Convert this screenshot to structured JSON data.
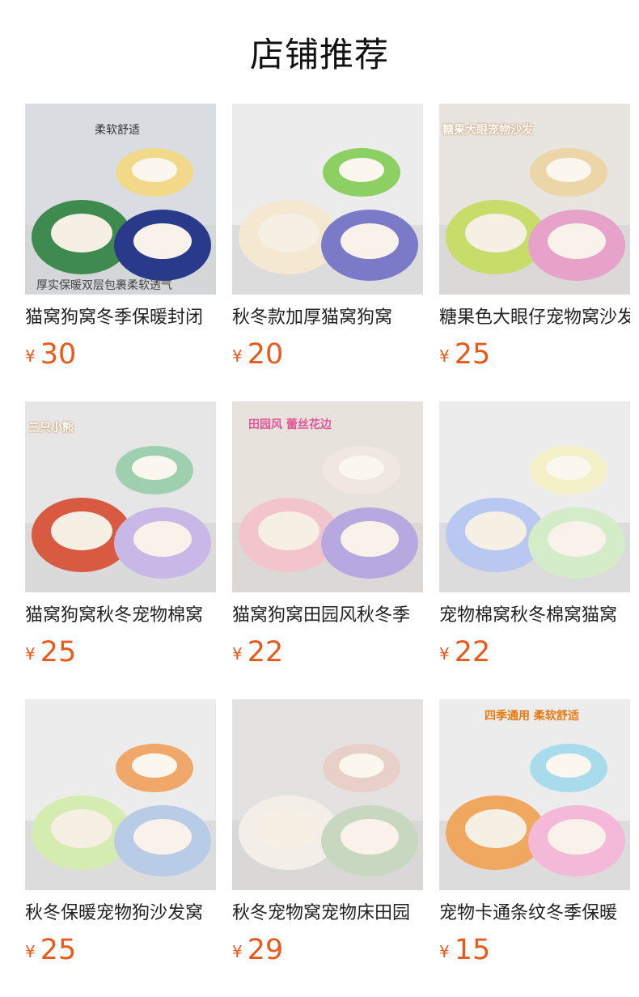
{
  "header": {
    "title": "店铺推荐"
  },
  "currency": "¥",
  "products": [
    {
      "title": "猫窝狗窝冬季保暖封闭",
      "price": "30",
      "overlay_top": "柔软舒适",
      "overlay_bottom": "厚实保暖双层包裹柔软透气",
      "colors": {
        "bg": "#d9dde2",
        "a": "#3f8a4e",
        "b": "#2a3a8a",
        "c": "#f2d98a"
      }
    },
    {
      "title": "秋冬款加厚猫窝狗窝",
      "price": "20",
      "overlay_top": "",
      "overlay_bottom": "",
      "colors": {
        "bg": "#ececec",
        "a": "#f4e8d0",
        "b": "#7a7ac8",
        "c": "#8ccf62"
      }
    },
    {
      "title": "糖果色大眼仔宠物窝沙发",
      "price": "25",
      "overlay_top": "糖果大眼宠物沙发",
      "overlay_bottom": "",
      "colors": {
        "bg": "#e8e4e0",
        "a": "#c8dc6a",
        "b": "#e6a2c8",
        "c": "#ecd6a8"
      }
    },
    {
      "title": "猫窝狗窝秋冬宠物棉窝",
      "price": "25",
      "overlay_top": "三只小熊",
      "overlay_bottom": "",
      "colors": {
        "bg": "#e6e6e6",
        "a": "#d85a40",
        "b": "#c8b8e8",
        "c": "#9ed0b0"
      }
    },
    {
      "title": "猫窝狗窝田园风秋冬季",
      "price": "22",
      "overlay_top": "田园风 蕾丝花边",
      "overlay_bottom": "",
      "colors": {
        "bg": "#e8e2dc",
        "a": "#f2c4cc",
        "b": "#b8a8e0",
        "c": "#f0e8e0"
      }
    },
    {
      "title": "宠物棉窝秋冬棉窝猫窝",
      "price": "22",
      "overlay_top": "",
      "overlay_bottom": "",
      "colors": {
        "bg": "#ececec",
        "a": "#b8c8f0",
        "b": "#d4ecc8",
        "c": "#f4f0c8"
      }
    },
    {
      "title": "秋冬保暖宠物狗沙发窝",
      "price": "25",
      "overlay_top": "",
      "overlay_bottom": "",
      "colors": {
        "bg": "#ececec",
        "a": "#d4ecb0",
        "b": "#b8cce8",
        "c": "#f0a86a"
      }
    },
    {
      "title": "秋冬宠物窝宠物床田园",
      "price": "29",
      "overlay_top": "",
      "overlay_bottom": "",
      "colors": {
        "bg": "#e4e2e0",
        "a": "#f4eee8",
        "b": "#c8d8c0",
        "c": "#e8d0c8"
      }
    },
    {
      "title": "宠物卡通条纹冬季保暖",
      "price": "15",
      "overlay_top": "四季通用 柔软舒适",
      "overlay_bottom": "",
      "colors": {
        "bg": "#ececec",
        "a": "#f0a860",
        "b": "#f4b8d8",
        "c": "#a8dcec"
      }
    }
  ]
}
